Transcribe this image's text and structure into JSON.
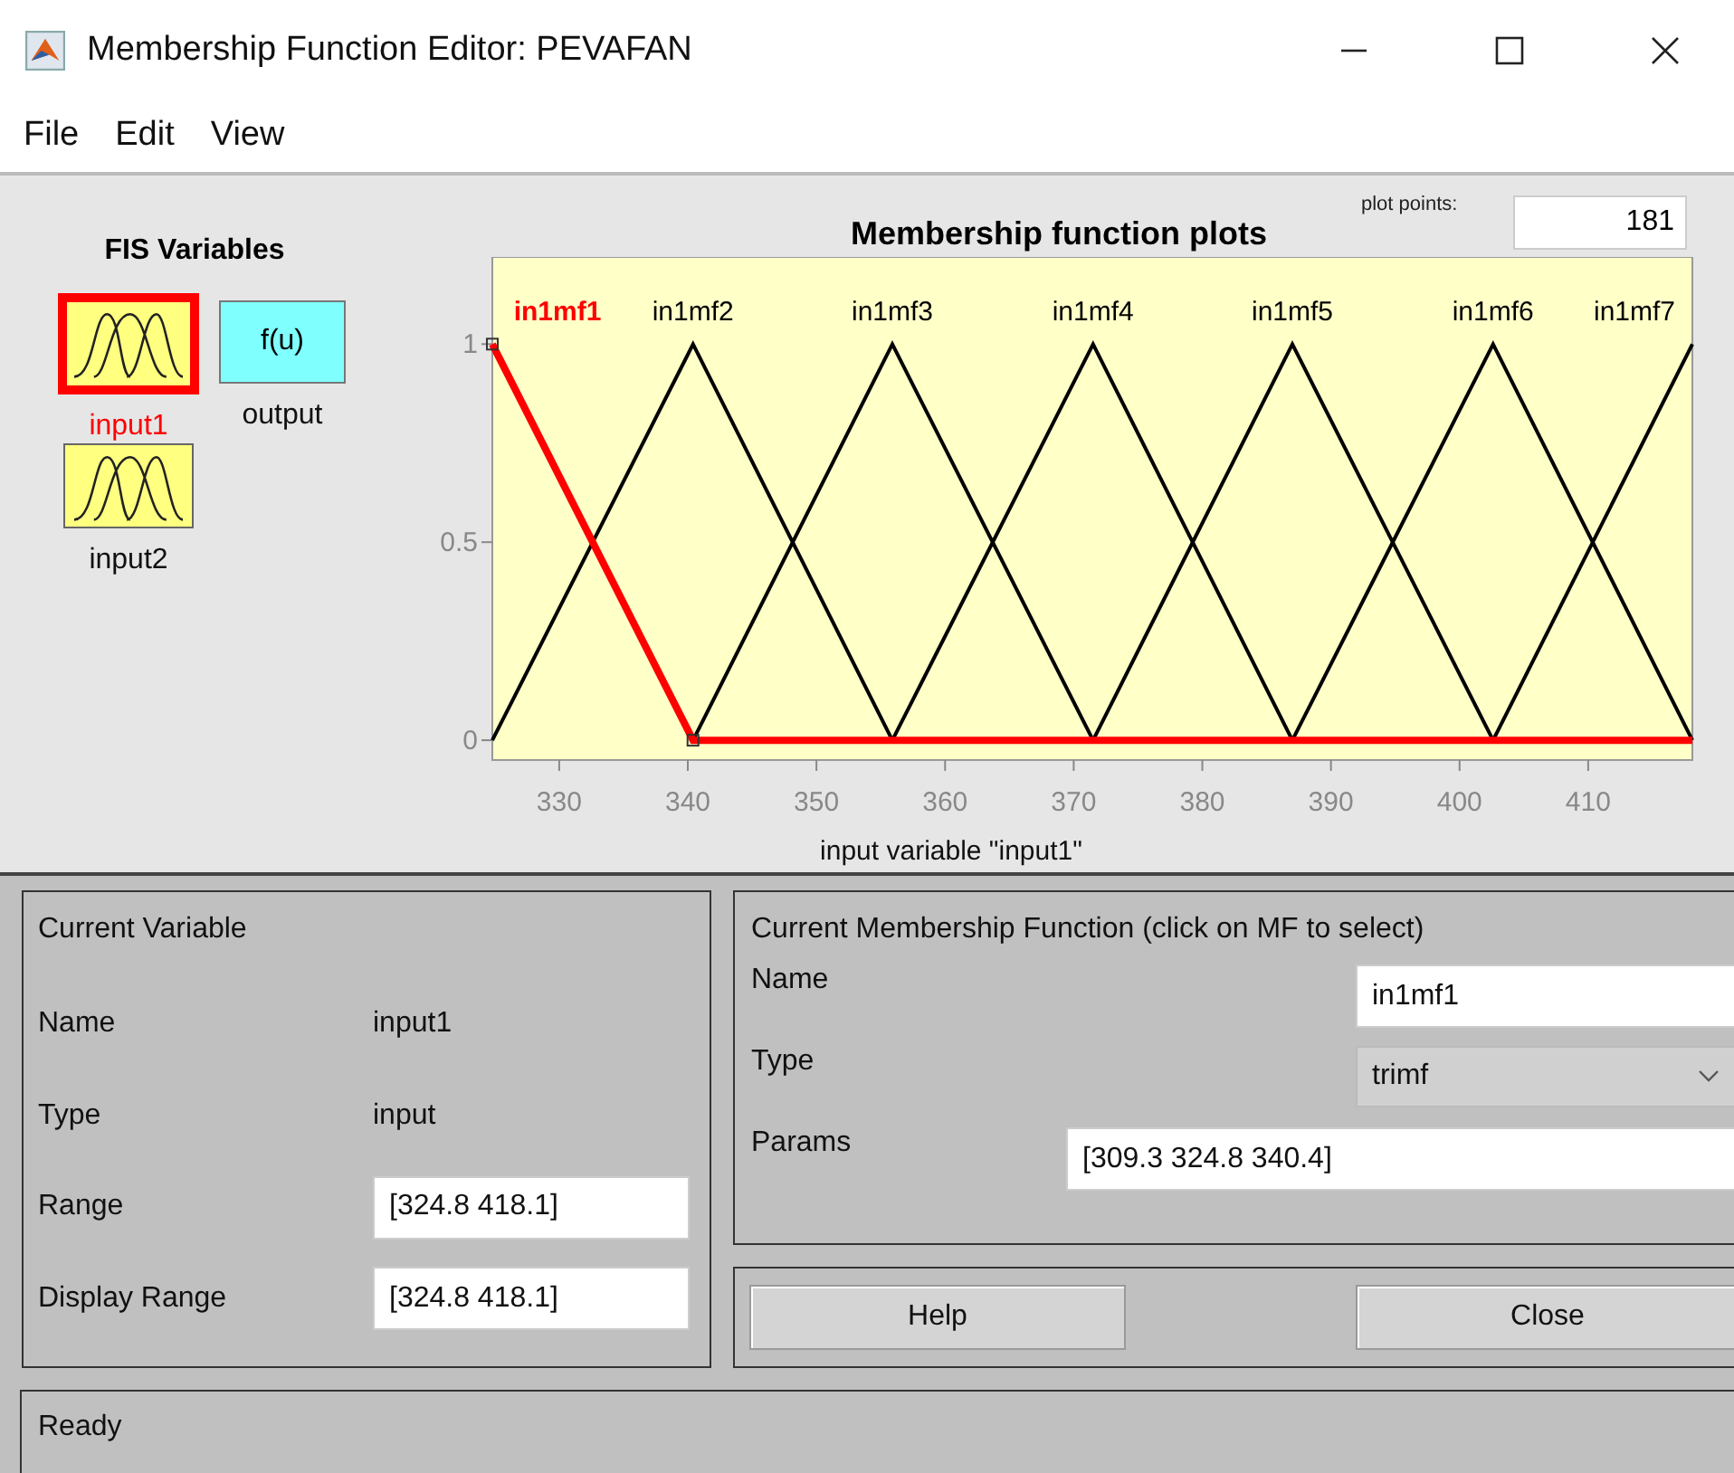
{
  "window": {
    "title": "Membership Function Editor: PEVAFAN"
  },
  "menu": [
    "File",
    "Edit",
    "View"
  ],
  "fis_variables": {
    "title": "FIS Variables",
    "items": [
      {
        "name": "input1",
        "kind": "input",
        "selected": true
      },
      {
        "name": "output",
        "kind": "output",
        "symbol": "f(u)",
        "selected": false
      },
      {
        "name": "input2",
        "kind": "input",
        "selected": false
      }
    ]
  },
  "plot": {
    "mf_selected": [
      true,
      false,
      false,
      false,
      false,
      false,
      false
    ],
    "plot_points_label": "plot points:",
    "plot_points": "181",
    "chart_data": {
      "type": "line",
      "title": "Membership function plots",
      "xlabel": "input variable \"input1\"",
      "x": [
        324.8,
        340.4,
        355.9,
        371.5,
        387.0,
        402.6,
        418.1
      ],
      "xlim": [
        324.8,
        418.1
      ],
      "ylim": [
        -0.05,
        1.22
      ],
      "xticks": [
        330,
        340,
        350,
        360,
        370,
        380,
        390,
        400,
        410
      ],
      "yticks": [
        0,
        0.5,
        1
      ],
      "legend": "top",
      "series": [
        {
          "name": "in1mf1",
          "color": "#ff0000",
          "values": [
            1,
            0,
            0,
            0,
            0,
            0,
            0
          ]
        },
        {
          "name": "in1mf2",
          "color": "#000000",
          "values": [
            0,
            1,
            0,
            null,
            null,
            null,
            null
          ]
        },
        {
          "name": "in1mf3",
          "color": "#000000",
          "values": [
            null,
            0,
            1,
            0,
            null,
            null,
            null
          ]
        },
        {
          "name": "in1mf4",
          "color": "#000000",
          "values": [
            null,
            null,
            0,
            1,
            0,
            null,
            null
          ]
        },
        {
          "name": "in1mf5",
          "color": "#000000",
          "values": [
            null,
            null,
            null,
            0,
            1,
            0,
            null
          ]
        },
        {
          "name": "in1mf6",
          "color": "#000000",
          "values": [
            null,
            null,
            null,
            null,
            0,
            1,
            0
          ]
        },
        {
          "name": "in1mf7",
          "color": "#000000",
          "values": [
            null,
            null,
            null,
            null,
            null,
            0,
            1
          ]
        }
      ]
    }
  },
  "current_variable": {
    "title": "Current Variable",
    "name_label": "Name",
    "name": "input1",
    "type_label": "Type",
    "type": "input",
    "range_label": "Range",
    "range": "[324.8 418.1]",
    "display_range_label": "Display Range",
    "display_range": "[324.8 418.1]"
  },
  "current_mf": {
    "title": "Current Membership Function (click on MF to select)",
    "name_label": "Name",
    "name": "in1mf1",
    "type_label": "Type",
    "type": "trimf",
    "params_label": "Params",
    "params": "[309.3 324.8 340.4]"
  },
  "buttons": [
    "Help",
    "Close"
  ],
  "status_bar": "Ready"
}
